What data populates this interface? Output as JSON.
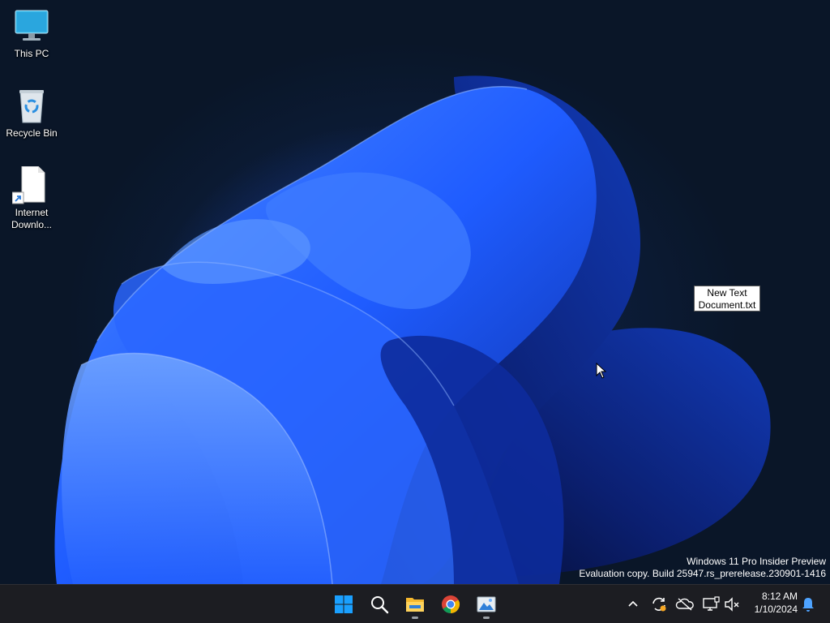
{
  "desktop": {
    "icons": [
      {
        "label": "This PC",
        "icon": "monitor-icon"
      },
      {
        "label": "Recycle Bin",
        "icon": "recycle-bin-icon"
      },
      {
        "label_line1": "Internet",
        "label_line2": "Downlo...",
        "icon": "document-shortcut-icon"
      }
    ],
    "selected_file": {
      "line1": "New Text",
      "line2": "Document.txt"
    },
    "watermark": {
      "line1": "Windows 11 Pro Insider Preview",
      "line2": "Evaluation copy. Build 25947.rs_prerelease.230901-1416"
    }
  },
  "taskbar": {
    "apps": [
      {
        "name": "start",
        "icon": "windows-logo-icon",
        "running": false
      },
      {
        "name": "search",
        "icon": "search-icon",
        "running": false
      },
      {
        "name": "file-explorer",
        "icon": "folder-icon",
        "running": true
      },
      {
        "name": "chrome",
        "icon": "chrome-icon",
        "running": false
      },
      {
        "name": "photos",
        "icon": "image-icon",
        "running": true
      }
    ],
    "tray": [
      "chevron-up-icon",
      "sync-icon",
      "onedrive-icon",
      "network-icon",
      "speaker-muted-icon"
    ],
    "clock": {
      "time": "8:12 AM",
      "date": "1/10/2024"
    },
    "notification_icon": "bell-icon"
  },
  "colors": {
    "taskbar_bg": "#1c1d22",
    "wallpaper_blue": "#1f5cff",
    "windows_blue": "#0a84ff"
  }
}
